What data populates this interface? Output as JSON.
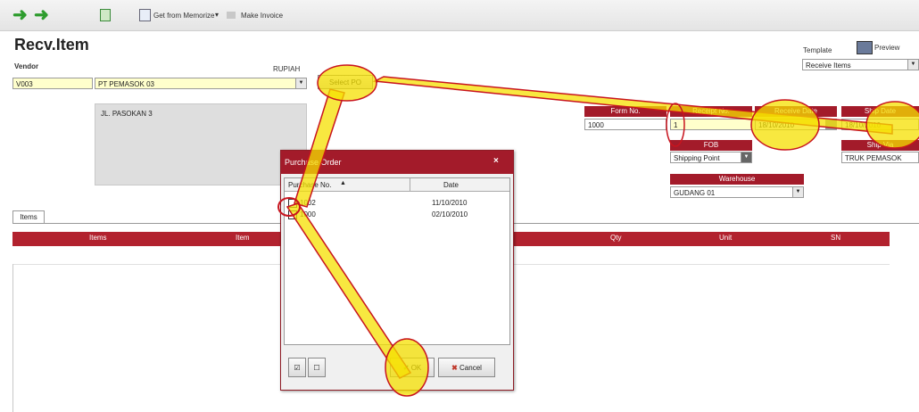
{
  "toolbar": {
    "get_from_memorize": "Get from Memorize",
    "make_invoice": "Make Invoice"
  },
  "page": {
    "title": "Recv.Item",
    "template_label": "Template",
    "preview_label": "Preview",
    "template_value": "Receive Items"
  },
  "vendor": {
    "label": "Vendor",
    "currency": "RUPIAH",
    "code": "V003",
    "name": "PT PEMASOK 03",
    "address": "JL. PASOKAN 3",
    "select_po": "Select PO"
  },
  "header_fields": {
    "form_no_label": "Form No.",
    "form_no_value": "1000",
    "receipt_no_label": "Receipt No.",
    "receipt_no_value": "1",
    "receive_date_label": "Receive Date",
    "receive_date_value": "18/10/2010",
    "ship_date_label": "Ship Date",
    "ship_date_value": "18/10/2010",
    "fob_label": "FOB",
    "fob_value": "Shipping Point",
    "ship_via_label": "Ship Via",
    "ship_via_value": "TRUK PEMASOK",
    "warehouse_label": "Warehouse",
    "warehouse_value": "GUDANG 01"
  },
  "grid": {
    "tab_label": "Items",
    "columns": [
      "Items",
      "Item",
      "Qty",
      "Unit",
      "SN"
    ]
  },
  "dialog": {
    "title": "Purchase Order",
    "col_po_no": "Purchase No.",
    "col_date": "Date",
    "rows": [
      {
        "po_no": "1002",
        "date": "11/10/2010"
      },
      {
        "po_no": "1000",
        "date": "02/10/2010"
      }
    ],
    "ok_label": "OK",
    "cancel_label": "Cancel"
  }
}
